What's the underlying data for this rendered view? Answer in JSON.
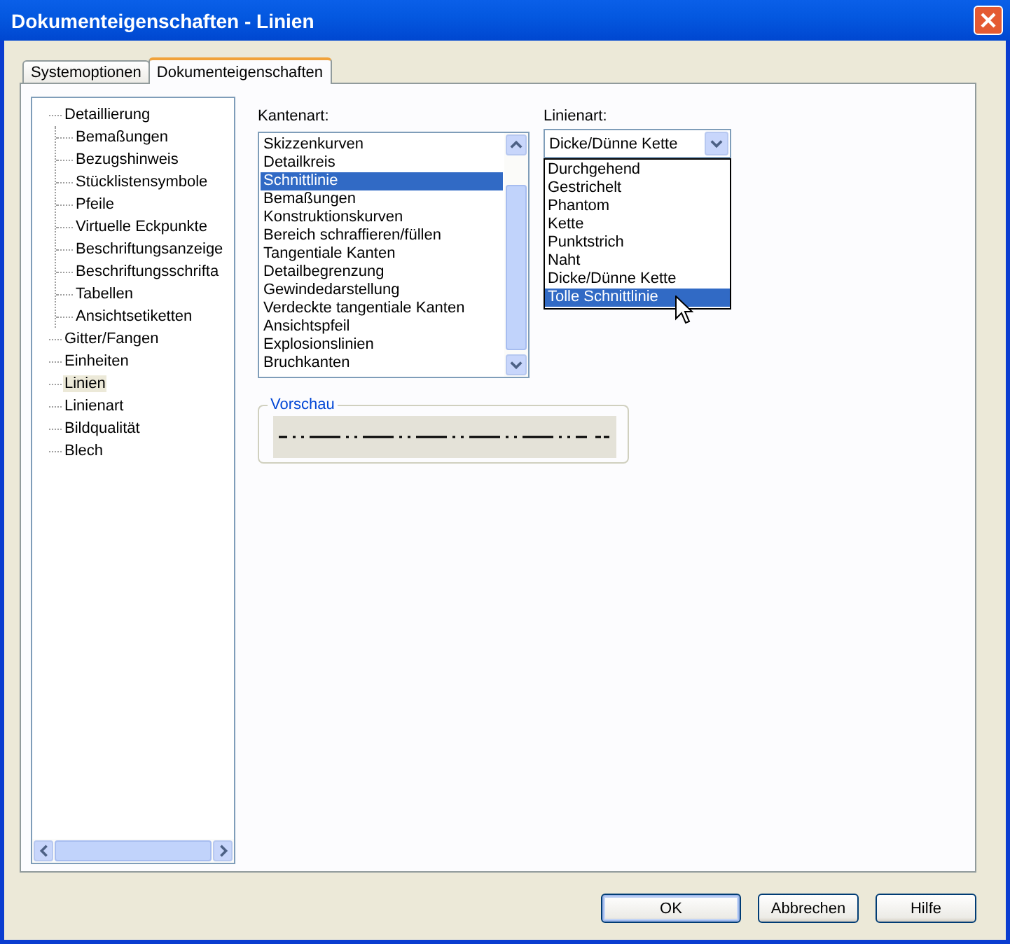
{
  "window": {
    "title": "Dokumenteigenschaften - Linien"
  },
  "tabs": [
    {
      "label": "Systemoptionen",
      "selected": false
    },
    {
      "label": "Dokumenteigenschaften",
      "selected": true
    }
  ],
  "tree": [
    {
      "label": "Detaillierung",
      "selected": false,
      "children": [
        {
          "label": "Bemaßungen",
          "selected": false
        },
        {
          "label": "Bezugshinweis",
          "selected": false
        },
        {
          "label": "Stücklistensymbole",
          "selected": false
        },
        {
          "label": "Pfeile",
          "selected": false
        },
        {
          "label": "Virtuelle Eckpunkte",
          "selected": false
        },
        {
          "label": "Beschriftungsanzeige",
          "selected": false
        },
        {
          "label": "Beschriftungsschrifta",
          "selected": false
        },
        {
          "label": "Tabellen",
          "selected": false
        },
        {
          "label": "Ansichtsetiketten",
          "selected": false
        }
      ]
    },
    {
      "label": "Gitter/Fangen",
      "selected": false
    },
    {
      "label": "Einheiten",
      "selected": false
    },
    {
      "label": "Linien",
      "selected": true
    },
    {
      "label": "Linienart",
      "selected": false
    },
    {
      "label": "Bildqualität",
      "selected": false
    },
    {
      "label": "Blech",
      "selected": false
    }
  ],
  "edge_types": {
    "label": "Kantenart:",
    "items": [
      {
        "label": "Skizzenkurven",
        "selected": false
      },
      {
        "label": "Detailkreis",
        "selected": false
      },
      {
        "label": "Schnittlinie",
        "selected": true
      },
      {
        "label": "Bemaßungen",
        "selected": false
      },
      {
        "label": "Konstruktionskurven",
        "selected": false
      },
      {
        "label": "Bereich schraffieren/füllen",
        "selected": false
      },
      {
        "label": "Tangentiale Kanten",
        "selected": false
      },
      {
        "label": "Detailbegrenzung",
        "selected": false
      },
      {
        "label": "Gewindedarstellung",
        "selected": false
      },
      {
        "label": "Verdeckte tangentiale Kanten",
        "selected": false
      },
      {
        "label": "Ansichtspfeil",
        "selected": false
      },
      {
        "label": "Explosionslinien",
        "selected": false
      },
      {
        "label": "Bruchkanten",
        "selected": false
      }
    ]
  },
  "line_type": {
    "label": "Linienart:",
    "value": "Dicke/Dünne Kette",
    "expanded": true,
    "options": [
      {
        "label": "Durchgehend",
        "highlighted": false
      },
      {
        "label": "Gestrichelt",
        "highlighted": false
      },
      {
        "label": "Phantom",
        "highlighted": false
      },
      {
        "label": "Kette",
        "highlighted": false
      },
      {
        "label": "Punktstrich",
        "highlighted": false
      },
      {
        "label": "Naht",
        "highlighted": false
      },
      {
        "label": "Dicke/Dünne Kette",
        "highlighted": false
      },
      {
        "label": "Tolle Schnittlinie",
        "highlighted": true
      }
    ]
  },
  "preview": {
    "title": "Vorschau"
  },
  "buttons": [
    {
      "label": "OK",
      "default": true
    },
    {
      "label": "Abbrechen",
      "default": false
    },
    {
      "label": "Hilfe",
      "default": false
    }
  ]
}
